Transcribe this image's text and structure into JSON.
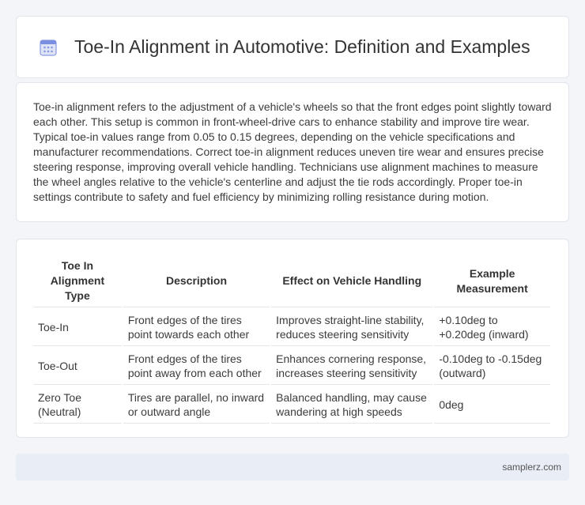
{
  "header": {
    "title": "Toe-In Alignment in Automotive: Definition and Examples",
    "icon": "calendar-icon"
  },
  "intro": {
    "text": "Toe-in alignment refers to the adjustment of a vehicle's wheels so that the front edges point slightly toward each other. This setup is common in front-wheel-drive cars to enhance stability and improve tire wear. Typical toe-in values range from 0.05 to 0.15 degrees, depending on the vehicle specifications and manufacturer recommendations. Correct toe-in alignment reduces uneven tire wear and ensures precise steering response, improving overall vehicle handling. Technicians use alignment machines to measure the wheel angles relative to the vehicle's centerline and adjust the tie rods accordingly. Proper toe-in settings contribute to safety and fuel efficiency by minimizing rolling resistance during motion."
  },
  "table": {
    "headers": [
      "Toe In Alignment Type",
      "Description",
      "Effect on Vehicle Handling",
      "Example Measurement"
    ],
    "rows": [
      [
        "Toe-In",
        "Front edges of the tires point towards each other",
        "Improves straight-line stability, reduces steering sensitivity",
        "+0.10deg to +0.20deg (inward)"
      ],
      [
        "Toe-Out",
        "Front edges of the tires point away from each other",
        "Enhances cornering response, increases steering sensitivity",
        "-0.10deg to -0.15deg (outward)"
      ],
      [
        "Zero Toe (Neutral)",
        "Tires are parallel, no inward or outward angle",
        "Balanced handling, may cause wandering at high speeds",
        "0deg"
      ]
    ]
  },
  "footer": {
    "text": "samplerz.com"
  },
  "colors": {
    "accent": "#7b8fe0",
    "background": "#f3f5f9"
  }
}
